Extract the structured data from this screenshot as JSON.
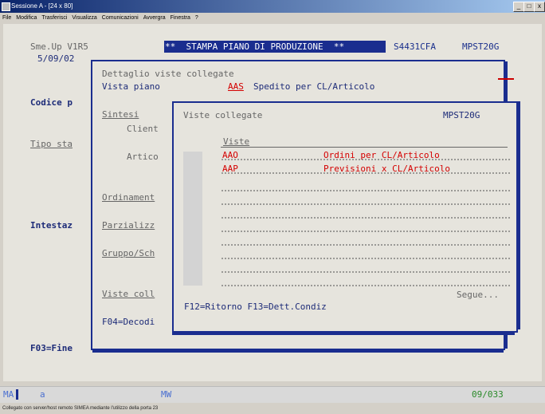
{
  "window": {
    "title": "Sessione A - [24 x 80]"
  },
  "menu": [
    "File",
    "Modifica",
    "Trasferisci",
    "Visualizza",
    "Comunicazioni",
    "Avvergra",
    "Finestra",
    "?"
  ],
  "screen": {
    "header_left": "Sme.Up V1R5",
    "date": "5/09/02",
    "header_title": "**  STAMPA PIANO DI PRODUZIONE  **",
    "code1": "S4431CFA",
    "code2": "MPST20G",
    "field_codice": "Codice p",
    "field_tipo": "Tipo sta",
    "field_intestaz": "Intestaz",
    "f03": "F03=Fine",
    "outer_panel": {
      "title": "Dettaglio viste collegate",
      "vista_label": "Vista piano",
      "vista_code": "AAS",
      "vista_desc": "Spedito per CL/Articolo",
      "sintesi": "Sintesi",
      "client": "Client",
      "artico": "Artico",
      "ordinament": "Ordinament",
      "parzializz": "Parzializz",
      "gruppo": "Gruppo/Sch",
      "viste_coll": "Viste coll",
      "f04": "F04=Decodi"
    },
    "inner_panel": {
      "title": "Viste collegate",
      "code": "MPST20G",
      "col_header": "Viste",
      "rows": [
        {
          "code": "AAO",
          "desc": "Ordini per CL/Articolo"
        },
        {
          "code": "AAP",
          "desc": "Previsioni x CL/Articolo"
        }
      ],
      "more": "Segue...",
      "fkeys": "F12=Ritorno F13=Dett.Condiz"
    }
  },
  "status": {
    "left": "MA",
    "session": "a",
    "mode": "MW",
    "cursor": "09/033"
  },
  "footer": "Collegato con server/host remoto SIMEA mediante l'utilizzo della porta 23"
}
